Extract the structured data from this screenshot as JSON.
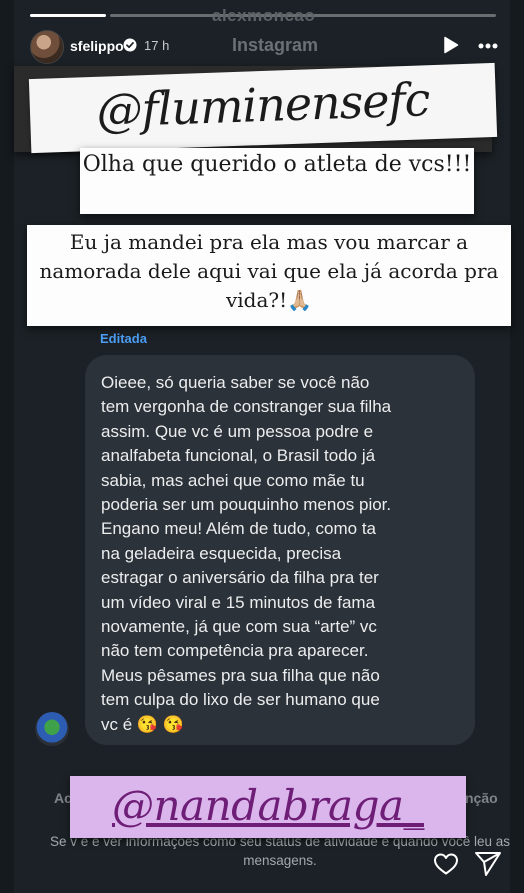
{
  "header": {
    "top_username": "alexmoncao",
    "username": "sfelippo",
    "time": "17 h",
    "app_label": "Instagram"
  },
  "progress": {
    "current_segment_fraction": 1.0,
    "segments": 2
  },
  "stickers": {
    "handle": "@fluminensefc",
    "line1": "Olha que querido o atleta de vcs!!!",
    "line2": "Eu ja mandei pra ela mas vou marcar a namorada dele aqui vai que ela já acorda pra vida?!🙏🏼",
    "bottom_handle": "@nandabraga_"
  },
  "message": {
    "edited_label": "Editada",
    "text": "Oieee, só queria saber se você não\ntem vergonha de constranger sua filha\nassim. Que vc é um pessoa podre e\nanalfabeta funcional, o Brasil todo já\nsabia, mas achei que como mãe tu\npoderia ser um pouquinho menos pior.\nEngano meu! Além de tudo, como ta\nna geladeira esquecida, precisa\nestragar o aniversário da filha pra ter\num vídeo viral e 15 minutos de fama\nnovamente, já que com sua “arte” vc\nnão tem competência pra aparecer.\nMeus pêsames pra sua filha que não\ntem culpa do lixo de ser humano que\nvc é 😘 😘"
  },
  "background": {
    "bottom_left": "Ac",
    "bottom_right": "nção",
    "footer_text": "Se v                                                          ê e ver informações como seu status de atividade e quando você leu as mensagens."
  },
  "icons": {
    "verified": "verified-badge-icon",
    "play": "play-icon",
    "more": "more-options-icon",
    "like": "heart-icon",
    "share": "send-icon"
  },
  "colors": {
    "edited_blue": "#4b9cf3",
    "bottom_sticker_bg": "#dbb6ec",
    "bottom_sticker_text": "#6e1e76"
  }
}
